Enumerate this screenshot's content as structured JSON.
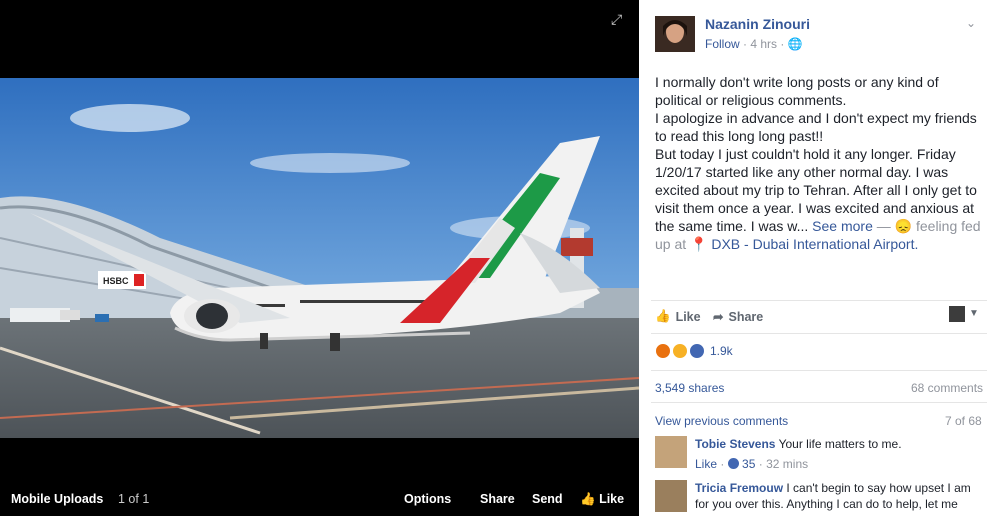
{
  "viewer": {
    "album": "Mobile Uploads",
    "position": "1 of 1",
    "options": "Options",
    "share": "Share",
    "send": "Send",
    "like": "Like",
    "sign_text": "HSBC"
  },
  "post": {
    "author": "Nazanin Zinouri",
    "follow": "Follow",
    "time": "4 hrs",
    "lines": [
      "I normally don't write long posts or any kind of",
      "political or religious comments.",
      "I apologize in advance and I don't expect my friends",
      "to read this long long past!!",
      "But today I just couldn't hold it any longer. Friday",
      "1/20/17 started like any other normal day. I was",
      "excited about my trip to Tehran. After all I only get to",
      "visit them once a year. I was excited and anxious at"
    ],
    "last_line_start": "the same time. I was w...",
    "see_more": "See more",
    "feeling": "— 😞 feeling fed",
    "feeling_cont": "up at",
    "location": "DXB - Dubai International Airport."
  },
  "actions": {
    "like": "Like",
    "share": "Share"
  },
  "reactions": {
    "count": "1.9k"
  },
  "stats": {
    "shares": "3,549 shares",
    "comments": "68 comments"
  },
  "comments_header": {
    "view_previous": "View previous comments",
    "count": "7 of 68"
  },
  "comments": [
    {
      "author": "Tobie Stevens",
      "text": "Your life matters to me.",
      "like": "Like",
      "likes": "35",
      "time": "32 mins"
    },
    {
      "author": "Tricia Fremouw",
      "text": "I can't begin to say how upset I am for you over this. Anything I can do to help, let me"
    }
  ],
  "colors": {
    "link": "#365899",
    "muted": "#90949c",
    "like_blue": "#4267b2",
    "angry": "#e9710f",
    "sad": "#f7b125"
  }
}
